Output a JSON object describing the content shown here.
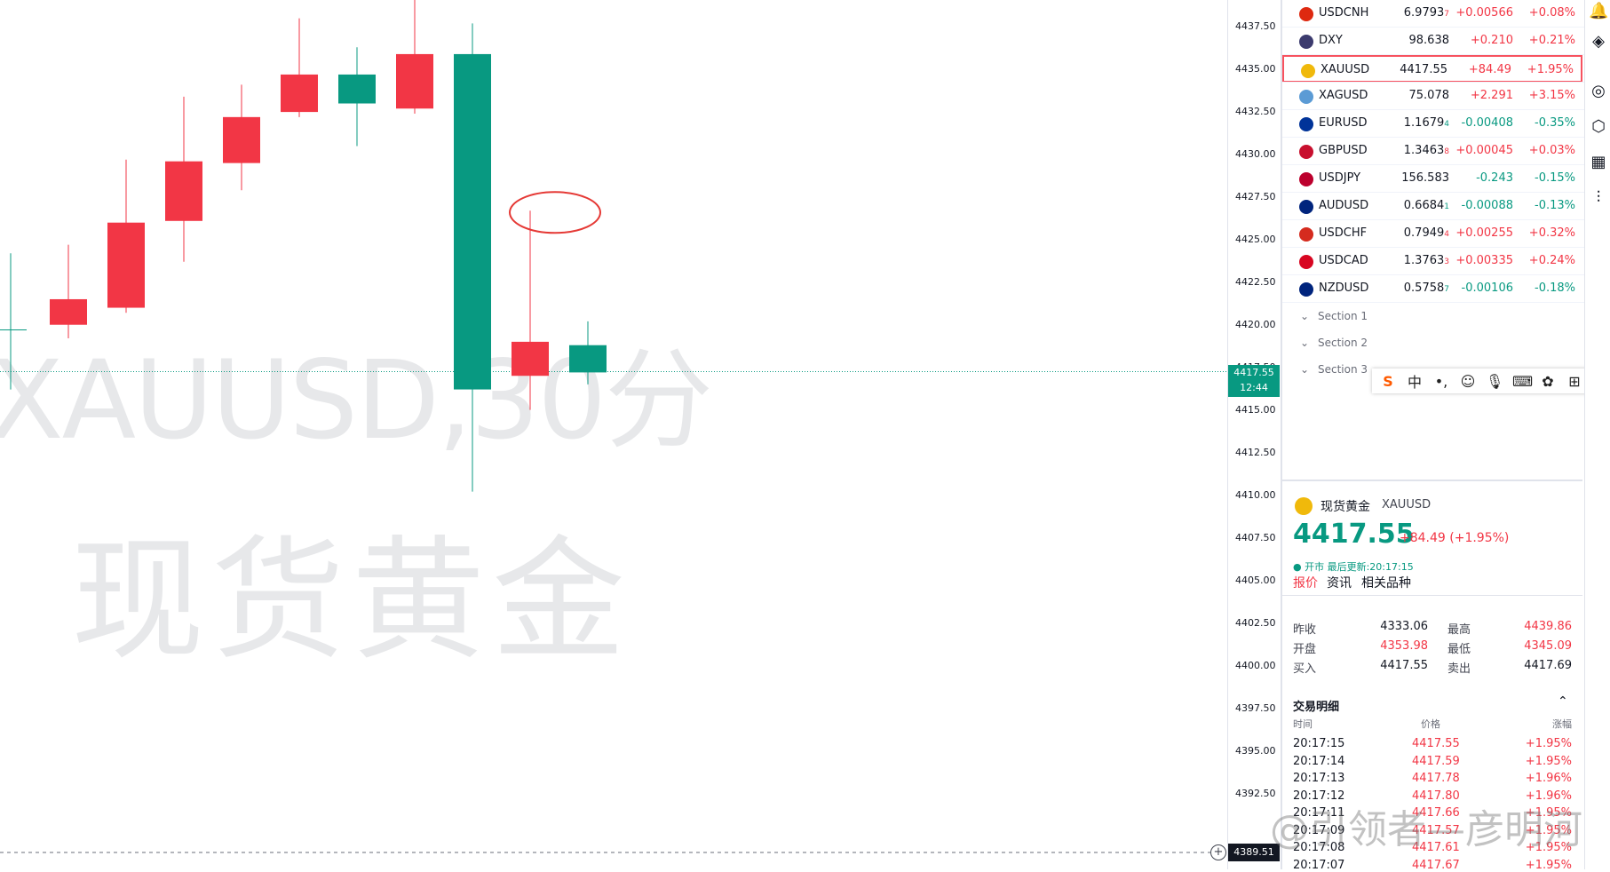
{
  "chart": {
    "watermark_symbol": "XAUUSD,30分",
    "watermark_name": "现货黄金",
    "price_ticks": [
      "4437.50",
      "4435.00",
      "4432.50",
      "4430.00",
      "4427.50",
      "4425.00",
      "4422.50",
      "4420.00",
      "4417.50",
      "4415.00",
      "4412.50",
      "4410.00",
      "4407.50",
      "4405.00",
      "4402.50",
      "4400.00",
      "4397.50",
      "4395.00",
      "4392.50"
    ],
    "last_price": "4417.55",
    "countdown": "12:44",
    "crosshair_price": "4389.51",
    "up_color": "#089981",
    "down_color": "#f23645",
    "annotation": "red ellipse marking upper wick",
    "candles": [
      {
        "o": 4420.0,
        "h": 4424.5,
        "l": 4416.5,
        "c": 4420.0
      },
      {
        "o": 4421.8,
        "h": 4425.0,
        "l": 4419.5,
        "c": 4420.3
      },
      {
        "o": 4426.3,
        "h": 4430.0,
        "l": 4421.0,
        "c": 4421.3
      },
      {
        "o": 4429.9,
        "h": 4433.7,
        "l": 4424.0,
        "c": 4426.4
      },
      {
        "o": 4432.5,
        "h": 4434.4,
        "l": 4428.2,
        "c": 4429.8
      },
      {
        "o": 4435.0,
        "h": 4438.3,
        "l": 4432.5,
        "c": 4432.8
      },
      {
        "o": 4433.3,
        "h": 4436.6,
        "l": 4430.8,
        "c": 4435.0
      },
      {
        "o": 4436.2,
        "h": 4439.8,
        "l": 4432.7,
        "c": 4433.0
      },
      {
        "o": 4416.5,
        "h": 4438.0,
        "l": 4410.5,
        "c": 4436.2
      },
      {
        "o": 4419.3,
        "h": 4427.0,
        "l": 4415.3,
        "c": 4417.3
      },
      {
        "o": 4417.5,
        "h": 4420.5,
        "l": 4416.8,
        "c": 4419.1
      }
    ]
  },
  "watchlist": {
    "rows": [
      {
        "symbol": "USDCNH",
        "last": "6.9793",
        "last_small": "7",
        "change": "+0.00566",
        "pct": "+0.08%",
        "dir": "pos",
        "flag": "#de2910"
      },
      {
        "symbol": "DXY",
        "last": "98.638",
        "last_small": "",
        "change": "+0.210",
        "pct": "+0.21%",
        "dir": "pos",
        "flag": "#3c3b6e"
      },
      {
        "symbol": "XAUUSD",
        "last": "4417.55",
        "last_small": "",
        "change": "+84.49",
        "pct": "+1.95%",
        "dir": "pos",
        "flag": "#f0b90b",
        "selected": true
      },
      {
        "symbol": "XAGUSD",
        "last": "75.078",
        "last_small": "",
        "change": "+2.291",
        "pct": "+3.15%",
        "dir": "pos",
        "flag": "#5b9bd5"
      },
      {
        "symbol": "EURUSD",
        "last": "1.1679",
        "last_small": "4",
        "change": "-0.00408",
        "pct": "-0.35%",
        "dir": "neg",
        "flag": "#003399"
      },
      {
        "symbol": "GBPUSD",
        "last": "1.3463",
        "last_small": "8",
        "change": "+0.00045",
        "pct": "+0.03%",
        "dir": "pos",
        "flag": "#c8102e"
      },
      {
        "symbol": "USDJPY",
        "last": "156.583",
        "last_small": "",
        "change": "-0.243",
        "pct": "-0.15%",
        "dir": "neg",
        "flag": "#bc002d"
      },
      {
        "symbol": "AUDUSD",
        "last": "0.6684",
        "last_small": "1",
        "change": "-0.00088",
        "pct": "-0.13%",
        "dir": "neg",
        "flag": "#00247d"
      },
      {
        "symbol": "USDCHF",
        "last": "0.7949",
        "last_small": "4",
        "change": "+0.00255",
        "pct": "+0.32%",
        "dir": "pos",
        "flag": "#d52b1e"
      },
      {
        "symbol": "USDCAD",
        "last": "1.3763",
        "last_small": "3",
        "change": "+0.00335",
        "pct": "+0.24%",
        "dir": "pos",
        "flag": "#d80621"
      },
      {
        "symbol": "NZDUSD",
        "last": "0.5758",
        "last_small": "7",
        "change": "-0.00106",
        "pct": "-0.18%",
        "dir": "neg",
        "flag": "#00247d"
      }
    ],
    "sections": [
      "Section 1",
      "Section 2",
      "Section 3"
    ]
  },
  "detail": {
    "name": "现货黄金",
    "code": "XAUUSD",
    "price": "4417.55",
    "change": "+84.49 (+1.95%)",
    "status": "● 开市 最后更新:20:17:15",
    "tabs": {
      "quote": "报价",
      "news": "资讯",
      "related": "相关品种"
    },
    "quote": {
      "prev_close_label": "昨收",
      "prev_close": "4333.06",
      "high_label": "最高",
      "high": "4439.86",
      "open_label": "开盘",
      "open": "4353.98",
      "low_label": "最低",
      "low": "4345.09",
      "bid_label": "买入",
      "bid": "4417.55",
      "ask_label": "卖出",
      "ask": "4417.69"
    },
    "trades_title": "交易明细",
    "trades_headers": {
      "time": "时间",
      "price": "价格",
      "pct": "涨幅"
    },
    "trades": [
      {
        "time": "20:17:15",
        "price": "4417.55",
        "pct": "+1.95%"
      },
      {
        "time": "20:17:14",
        "price": "4417.59",
        "pct": "+1.95%"
      },
      {
        "time": "20:17:13",
        "price": "4417.78",
        "pct": "+1.96%"
      },
      {
        "time": "20:17:12",
        "price": "4417.80",
        "pct": "+1.96%"
      },
      {
        "time": "20:17:11",
        "price": "4417.66",
        "pct": "+1.95%"
      },
      {
        "time": "20:17:09",
        "price": "4417.57",
        "pct": "+1.95%"
      },
      {
        "time": "20:17:08",
        "price": "4417.61",
        "pct": "+1.95%"
      },
      {
        "time": "20:17:07",
        "price": "4417.67",
        "pct": "+1.95%"
      }
    ]
  },
  "ime_bar": {
    "items": [
      "S",
      "中",
      "•,",
      "☺",
      "🎙",
      "⌨",
      "✿",
      "⊞",
      "👕"
    ]
  },
  "right_toolbar": {
    "icons": [
      "bell-icon",
      "layers-icon",
      "target-icon",
      "stack-icon",
      "calendar-icon",
      "chart-icon"
    ]
  },
  "weibo_watermark": "@引领者—彦明河"
}
